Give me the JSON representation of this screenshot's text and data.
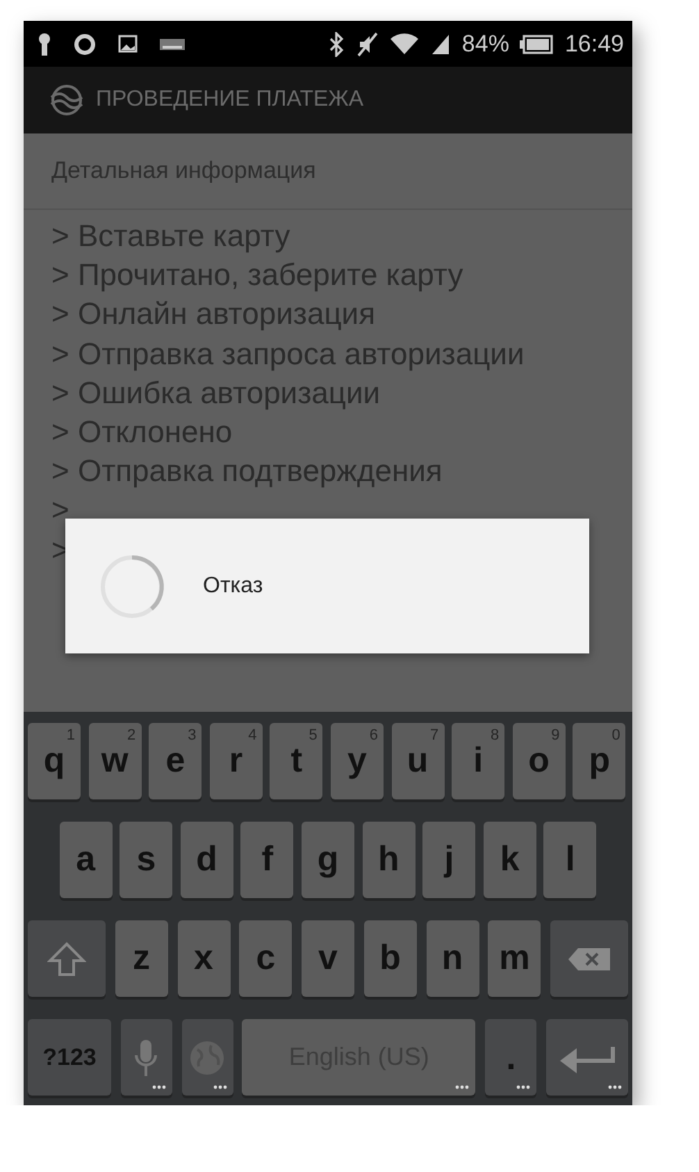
{
  "status_bar": {
    "battery": "84%",
    "time": "16:49"
  },
  "app_bar": {
    "title": "ПРОВЕДЕНИЕ ПЛАТЕЖА"
  },
  "section_title": "Детальная информация",
  "log": [
    "> Вставьте карту",
    "> Прочитано, заберите карту",
    "> Онлайн авторизация",
    "> Отправка запроса авторизации",
    "> Ошибка авторизации",
    "> Отклонено",
    "> Отправка подтверждения",
    ">",
    ">"
  ],
  "dialog": {
    "message": "Отказ"
  },
  "keyboard": {
    "key_rows": [
      {
        "keys": [
          {
            "kind": "letter",
            "label": "q",
            "hint": "1"
          },
          {
            "kind": "letter",
            "label": "w",
            "hint": "2"
          },
          {
            "kind": "letter",
            "label": "e",
            "hint": "3"
          },
          {
            "kind": "letter",
            "label": "r",
            "hint": "4"
          },
          {
            "kind": "letter",
            "label": "t",
            "hint": "5"
          },
          {
            "kind": "letter",
            "label": "y",
            "hint": "6"
          },
          {
            "kind": "letter",
            "label": "u",
            "hint": "7"
          },
          {
            "kind": "letter",
            "label": "i",
            "hint": "8"
          },
          {
            "kind": "letter",
            "label": "o",
            "hint": "9"
          },
          {
            "kind": "letter",
            "label": "p",
            "hint": "0"
          }
        ]
      },
      {
        "keys": [
          {
            "kind": "letter",
            "label": "a"
          },
          {
            "kind": "letter",
            "label": "s"
          },
          {
            "kind": "letter",
            "label": "d"
          },
          {
            "kind": "letter",
            "label": "f"
          },
          {
            "kind": "letter",
            "label": "g"
          },
          {
            "kind": "letter",
            "label": "h"
          },
          {
            "kind": "letter",
            "label": "j"
          },
          {
            "kind": "letter",
            "label": "k"
          },
          {
            "kind": "letter",
            "label": "l"
          }
        ]
      },
      {
        "keys": [
          {
            "kind": "shift"
          },
          {
            "kind": "letter",
            "label": "z"
          },
          {
            "kind": "letter",
            "label": "x"
          },
          {
            "kind": "letter",
            "label": "c"
          },
          {
            "kind": "letter",
            "label": "v"
          },
          {
            "kind": "letter",
            "label": "b"
          },
          {
            "kind": "letter",
            "label": "n"
          },
          {
            "kind": "letter",
            "label": "m"
          },
          {
            "kind": "backspace"
          }
        ]
      },
      {
        "keys": [
          {
            "kind": "symbols",
            "label": "?123"
          },
          {
            "kind": "mic"
          },
          {
            "kind": "globe"
          },
          {
            "kind": "space",
            "label": "English (US)"
          },
          {
            "kind": "period",
            "label": "."
          },
          {
            "kind": "enter"
          }
        ]
      }
    ]
  }
}
